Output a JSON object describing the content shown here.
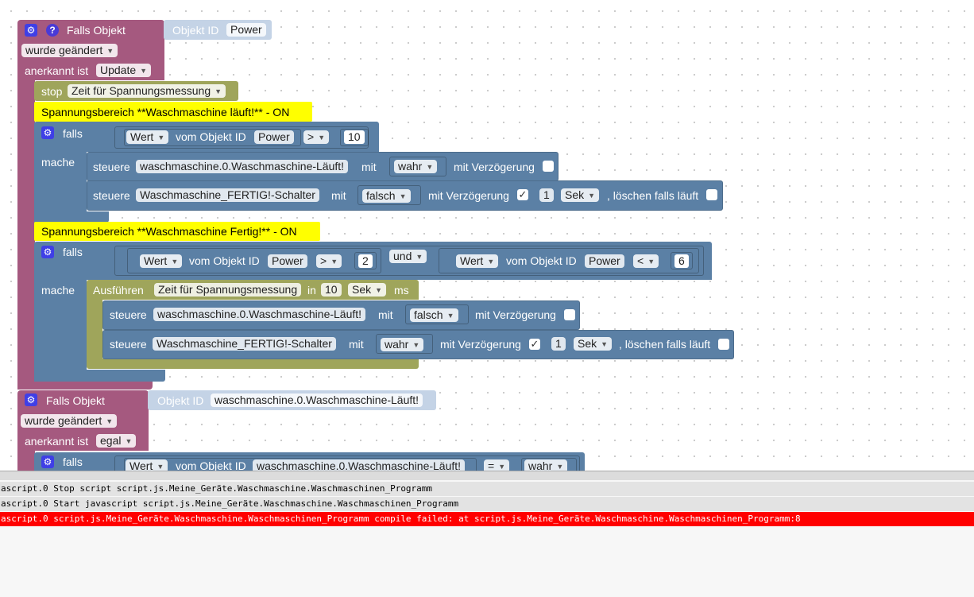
{
  "block1": {
    "title": "Falls Objekt",
    "object_id_label": "Objekt ID",
    "object_id_value": "Power",
    "trigger_value": "wurde geändert",
    "ack_label": "anerkannt ist",
    "ack_value": "Update",
    "stop_label": "stop",
    "stop_timer": "Zeit für Spannungsmessung",
    "comment1": "Spannungsbereich  **Waschmaschine läuft!** - ON",
    "if1": {
      "falls_label": "falls",
      "mache_label": "mache",
      "cond_field": "Wert",
      "cond_of": "vom Objekt ID",
      "cond_obj": "Power",
      "cond_op": ">",
      "cond_num": "10",
      "control1_label": "steuere",
      "control1_target": "waschmaschine.0.Waschmaschine-Läuft!",
      "control1_mit": "mit",
      "control1_value": "wahr",
      "control1_delay_label": "mit Verzögerung",
      "control2_label": "steuere",
      "control2_target": "Waschmaschine_FERTIG!-Schalter",
      "control2_mit": "mit",
      "control2_value": "falsch",
      "control2_delay_label": "mit Verzögerung",
      "control2_check": "✓",
      "control2_delay_num": "1",
      "control2_delay_unit": "Sek",
      "control2_clear_label": ", löschen falls läuft"
    },
    "comment2": "Spannungsbereich  **Waschmaschine Fertig!** - ON",
    "if2": {
      "falls_label": "falls",
      "mache_label": "mache",
      "condA_field": "Wert",
      "condA_of": "vom Objekt ID",
      "condA_obj": "Power",
      "condA_op": ">",
      "condA_num": "2",
      "logic": "und",
      "condB_field": "Wert",
      "condB_of": "vom Objekt ID",
      "condB_obj": "Power",
      "condB_op": "<",
      "condB_num": "6",
      "exec_label": "Ausführen",
      "exec_timer": "Zeit für Spannungsmessung",
      "exec_in": "in",
      "exec_num": "10",
      "exec_unit": "Sek",
      "exec_ms": "ms",
      "control1_label": "steuere",
      "control1_target": "waschmaschine.0.Waschmaschine-Läuft!",
      "control1_mit": "mit",
      "control1_value": "falsch",
      "control1_delay_label": "mit Verzögerung",
      "control2_label": "steuere",
      "control2_target": "Waschmaschine_FERTIG!-Schalter",
      "control2_mit": "mit",
      "control2_value": "wahr",
      "control2_delay_label": "mit Verzögerung",
      "control2_check": "✓",
      "control2_delay_num": "1",
      "control2_delay_unit": "Sek",
      "control2_clear_label": ", löschen falls läuft"
    }
  },
  "block2": {
    "title": "Falls Objekt",
    "object_id_label": "Objekt ID",
    "object_id_value": "waschmaschine.0.Waschmaschine-Läuft!",
    "trigger_value": "wurde geändert",
    "ack_label": "anerkannt ist",
    "ack_value": "egal",
    "falls_label": "falls",
    "cond_field": "Wert",
    "cond_of": "vom Objekt ID",
    "cond_obj": "waschmaschine.0.Waschmaschine-Läuft!",
    "cond_op": "=",
    "cond_value": "wahr"
  },
  "icons": {
    "gear": "gear-icon",
    "help": "help-icon"
  },
  "colors": {
    "event": "#a5597f",
    "logic": "#5b80a5",
    "timer": "#9fa55b",
    "comment": "#ffff00",
    "error": "#ff0000"
  },
  "log": [
    {
      "text": "ascript.0 Stop script script.js.Meine_Geräte.Waschmaschine.Waschmaschinen_Programm",
      "level": "info"
    },
    {
      "text": "ascript.0 Start javascript script.js.Meine_Geräte.Waschmaschine.Waschmaschinen_Programm",
      "level": "info"
    },
    {
      "text": "ascript.0 script.js.Meine_Geräte.Waschmaschine.Waschmaschinen_Programm compile failed: at script.js.Meine_Geräte.Waschmaschine.Waschmaschinen_Programm:8",
      "level": "error"
    }
  ]
}
